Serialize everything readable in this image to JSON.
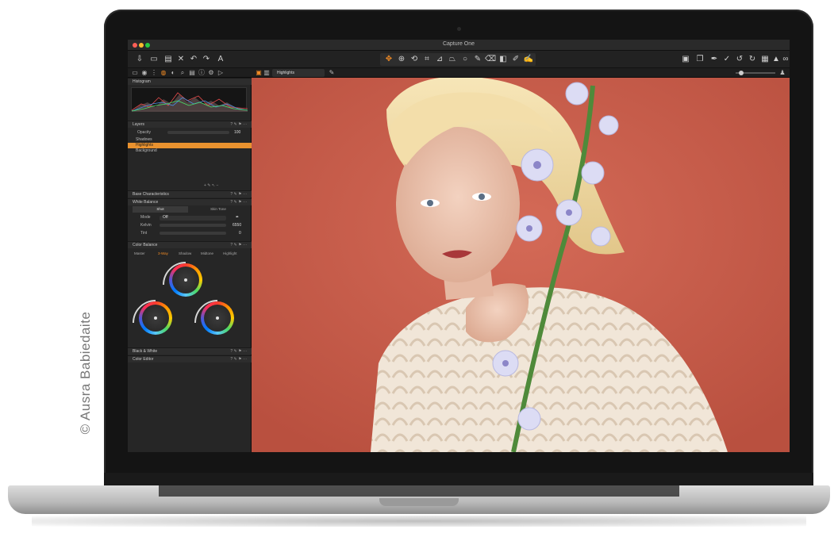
{
  "credit": "© Ausra Babiedaite",
  "app": {
    "window_title": "Capture One"
  },
  "toolbar": {
    "left_icons": [
      "import-icon",
      "camera-icon",
      "collection-icon",
      "delete-icon",
      "undo-icon",
      "redo-icon",
      "text-icon"
    ],
    "center_icons": [
      "pan-icon",
      "zoom-icon",
      "rotate-icon",
      "crop-icon",
      "straighten-icon",
      "keystone-icon",
      "spot-icon",
      "brush-icon",
      "eraser-icon",
      "gradient-icon",
      "picker-icon",
      "annotate-icon"
    ],
    "right_icons": [
      "browse-icon",
      "stack-icon",
      "eyedropper-icon",
      "copy-adjustments-icon",
      "reset-icon",
      "reload-icon",
      "grid-icon",
      "warning-icon",
      "proof-icon"
    ]
  },
  "viewer_bar": {
    "layer_select": "Highlights",
    "layer_icon": "brush-icon"
  },
  "panel": {
    "histogram": {
      "title": "Histogram"
    },
    "layers": {
      "title": "Layers",
      "opacity_label": "Opacity",
      "opacity_value": "100",
      "items": [
        {
          "name": "Shadows",
          "selected": false
        },
        {
          "name": "Highlights",
          "selected": true
        },
        {
          "name": "Background",
          "selected": false
        }
      ]
    },
    "base_characteristics": {
      "title": "Base Characteristics"
    },
    "white_balance": {
      "title": "White Balance",
      "tabs": [
        "Shot",
        "Skin Tone"
      ],
      "mode_label": "Mode",
      "mode_value": "Off",
      "kelvin_label": "Kelvin",
      "kelvin_value": "6550",
      "tint_label": "Tint",
      "tint_value": "0"
    },
    "color_balance": {
      "title": "Color Balance",
      "tabs": [
        "Master",
        "3-Way",
        "Shadow",
        "Midtone",
        "Highlight"
      ],
      "active_tab": "3-Way"
    },
    "black_white": {
      "title": "Black & White"
    },
    "color_editor": {
      "title": "Color Editor"
    }
  },
  "colors": {
    "accent": "#f08a24",
    "backdrop": "#cf5f4e",
    "panel": "#262626"
  }
}
